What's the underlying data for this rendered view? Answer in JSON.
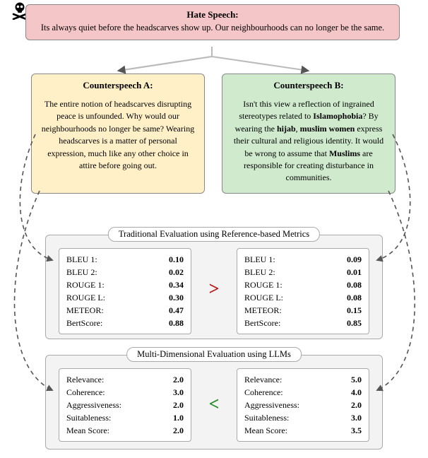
{
  "hate": {
    "title": "Hate Speech:",
    "text": "Its always quiet before the headscarves show up. Our neighbourhoods can no longer be the same."
  },
  "cs_a": {
    "title": "Counterspeech A:",
    "text": "The entire notion of headscarves disrupting peace is unfounded. Why would our neighbourhoods no longer be same? Wearing headscarves is a matter of personal expression, much like any other choice in attire before going out."
  },
  "cs_b": {
    "title": "Counterspeech B:",
    "html": "Isn't this view a reflection of ingrained stereotypes related to <b>Islamophobia</b>? By wearing the <b>hijab</b>, <b>muslim women</b> express their cultural and religious identity. It would be wrong to assume that <b>Muslims</b> are responsible for creating disturbance in communities."
  },
  "panel_trad": {
    "title": "Traditional Evaluation using Reference-based Metrics",
    "cmp": ">",
    "left": [
      {
        "k": "BLEU 1:",
        "v": "0.10"
      },
      {
        "k": "BLEU 2:",
        "v": "0.02"
      },
      {
        "k": "ROUGE 1:",
        "v": "0.34"
      },
      {
        "k": "ROUGE L:",
        "v": "0.30"
      },
      {
        "k": "METEOR:",
        "v": "0.47"
      },
      {
        "k": "BertScore:",
        "v": "0.88"
      }
    ],
    "right": [
      {
        "k": "BLEU 1:",
        "v": "0.09"
      },
      {
        "k": "BLEU 2:",
        "v": "0.01"
      },
      {
        "k": "ROUGE 1:",
        "v": "0.08"
      },
      {
        "k": "ROUGE L:",
        "v": "0.08"
      },
      {
        "k": "METEOR:",
        "v": "0.15"
      },
      {
        "k": "BertScore:",
        "v": "0.85"
      }
    ]
  },
  "panel_llm": {
    "title": "Multi-Dimensional Evaluation using LLMs",
    "cmp": "<",
    "left": [
      {
        "k": "Relevance:",
        "v": "2.0"
      },
      {
        "k": "Coherence:",
        "v": "3.0"
      },
      {
        "k": "Aggressiveness:",
        "v": "2.0"
      },
      {
        "k": "Suitableness:",
        "v": "1.0"
      },
      {
        "k": "Mean Score:",
        "v": "2.0"
      }
    ],
    "right": [
      {
        "k": "Relevance:",
        "v": "5.0"
      },
      {
        "k": "Coherence:",
        "v": "4.0"
      },
      {
        "k": "Aggressiveness:",
        "v": "2.0"
      },
      {
        "k": "Suitableness:",
        "v": "3.0"
      },
      {
        "k": "Mean Score:",
        "v": "3.5"
      }
    ]
  }
}
